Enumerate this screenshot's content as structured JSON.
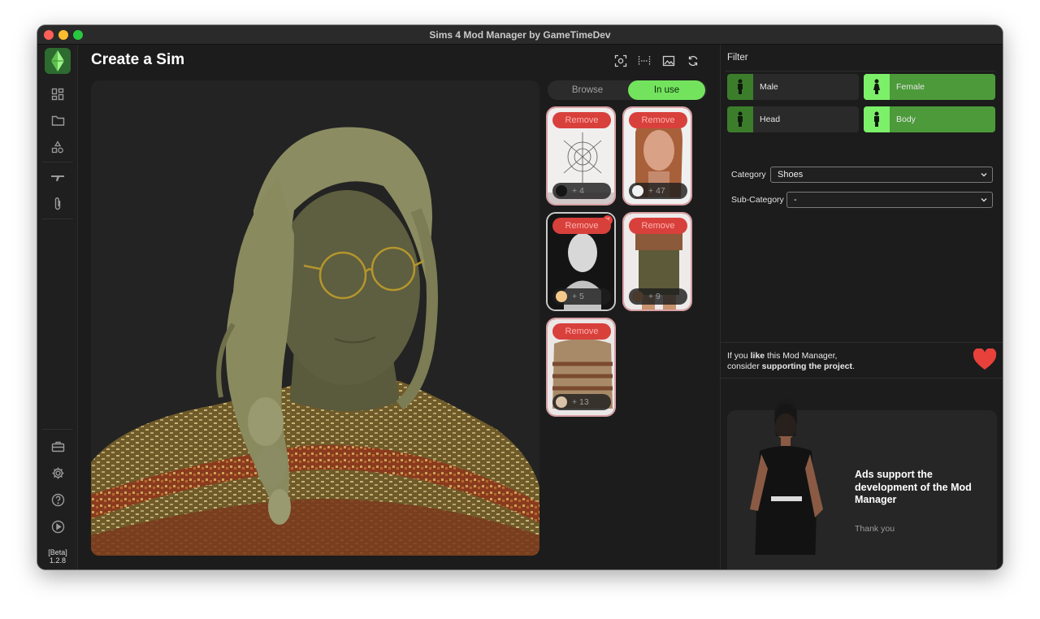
{
  "window": {
    "title": "Sims 4 Mod Manager by GameTimeDev"
  },
  "sidebar": {
    "items": [
      {
        "name": "dashboard-icon"
      },
      {
        "name": "folder-icon"
      },
      {
        "name": "shapes-icon"
      },
      {
        "name": "plane-icon"
      },
      {
        "name": "paperclip-icon"
      },
      {
        "name": "toolbox-icon"
      },
      {
        "name": "gear-icon"
      },
      {
        "name": "help-icon"
      },
      {
        "name": "play-icon"
      }
    ],
    "version_tag": "[Beta]",
    "version": "1.2.8"
  },
  "main": {
    "title": "Create a Sim",
    "toolbar_icons": [
      "focus-icon",
      "fit-width-icon",
      "image-icon",
      "refresh-icon"
    ]
  },
  "tabs": {
    "browse": "Browse",
    "in_use": "In use",
    "active": "In use"
  },
  "cards": [
    {
      "remove_label": "Remove",
      "count": "+ 4",
      "swatch": "#151515",
      "badge": false
    },
    {
      "remove_label": "Remove",
      "count": "+ 47",
      "swatch": "#f2f2f2",
      "badge": false
    },
    {
      "remove_label": "Remove",
      "count": "+ 5",
      "swatch": "#f4c98a",
      "badge": true
    },
    {
      "remove_label": "Remove",
      "count": "+ 9",
      "swatch": "#4a3a2c",
      "badge": false
    },
    {
      "remove_label": "Remove",
      "count": "+ 13",
      "swatch": "#d9c3a9",
      "badge": false
    }
  ],
  "filter": {
    "title": "Filter",
    "gender": [
      {
        "label": "Male",
        "active": false
      },
      {
        "label": "Female",
        "active": true
      }
    ],
    "part": [
      {
        "label": "Head",
        "active": false
      },
      {
        "label": "Body",
        "active": true
      }
    ],
    "category_label": "Category",
    "category_value": "Shoes",
    "subcategory_label": "Sub-Category",
    "subcategory_value": "-"
  },
  "support": {
    "line1_prefix": "If you ",
    "line1_bold": "like",
    "line1_suffix": " this Mod Manager,",
    "line2_prefix": "consider ",
    "line2_bold": "supporting the project",
    "line2_suffix": ".",
    "heart_color": "#e8413b"
  },
  "ad": {
    "headline": "Ads support the development of the Mod Manager",
    "thanks": "Thank you"
  },
  "colors": {
    "accent_green": "#73e35e",
    "remove_red": "#d8403c",
    "filter_active": "#4c9a3a"
  }
}
